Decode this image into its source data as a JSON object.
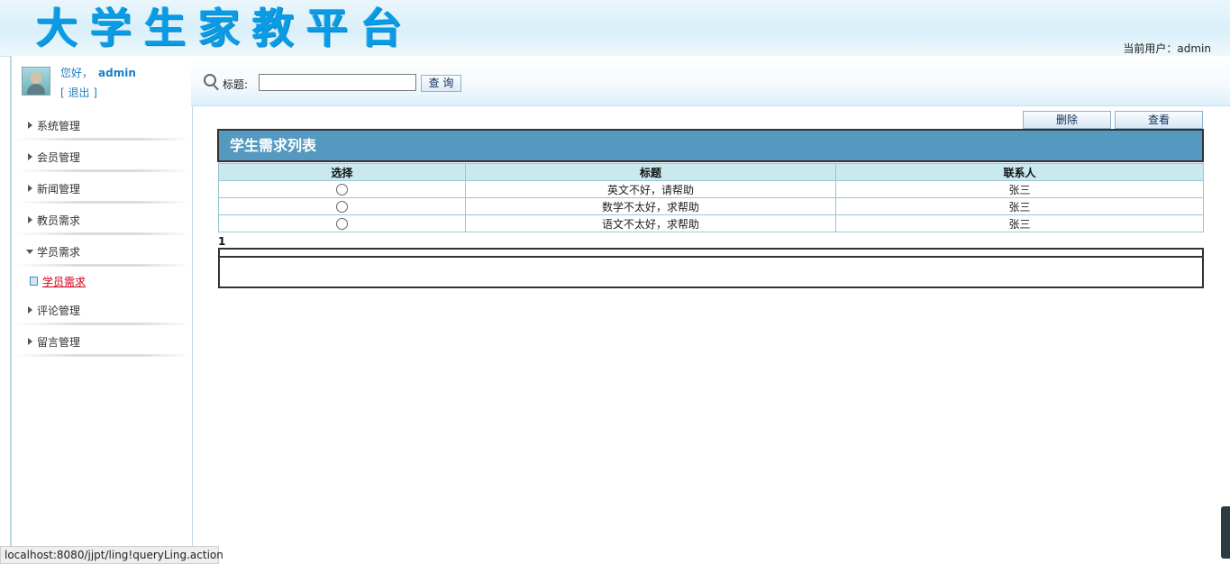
{
  "header": {
    "logo_text": "大学生家教平台",
    "current_user_label": "当前用户：admin"
  },
  "sidebar": {
    "greeting": "您好，",
    "username": "admin",
    "logout": "[ 退出 ]",
    "menu": [
      {
        "label": "系统管理",
        "expanded": false
      },
      {
        "label": "会员管理",
        "expanded": false
      },
      {
        "label": "新闻管理",
        "expanded": false
      },
      {
        "label": "教员需求",
        "expanded": false
      },
      {
        "label": "学员需求",
        "expanded": true,
        "children": [
          {
            "label": "学员需求"
          }
        ]
      },
      {
        "label": "评论管理",
        "expanded": false
      },
      {
        "label": "留言管理",
        "expanded": false
      }
    ]
  },
  "search": {
    "label": "标题:",
    "value": "",
    "button": "查 询"
  },
  "actions": {
    "delete": "删除",
    "view": "查看"
  },
  "list": {
    "title": "学生需求列表",
    "columns": [
      "选择",
      "标题",
      "联系人"
    ],
    "rows": [
      {
        "title": "英文不好，请帮助",
        "contact": "张三"
      },
      {
        "title": "数学不太好，求帮助",
        "contact": "张三"
      },
      {
        "title": "语文不太好，求帮助",
        "contact": "张三"
      }
    ],
    "page": "1"
  },
  "statusbar": {
    "url": "localhost:8080/jjpt/ling!queryLing.action"
  }
}
